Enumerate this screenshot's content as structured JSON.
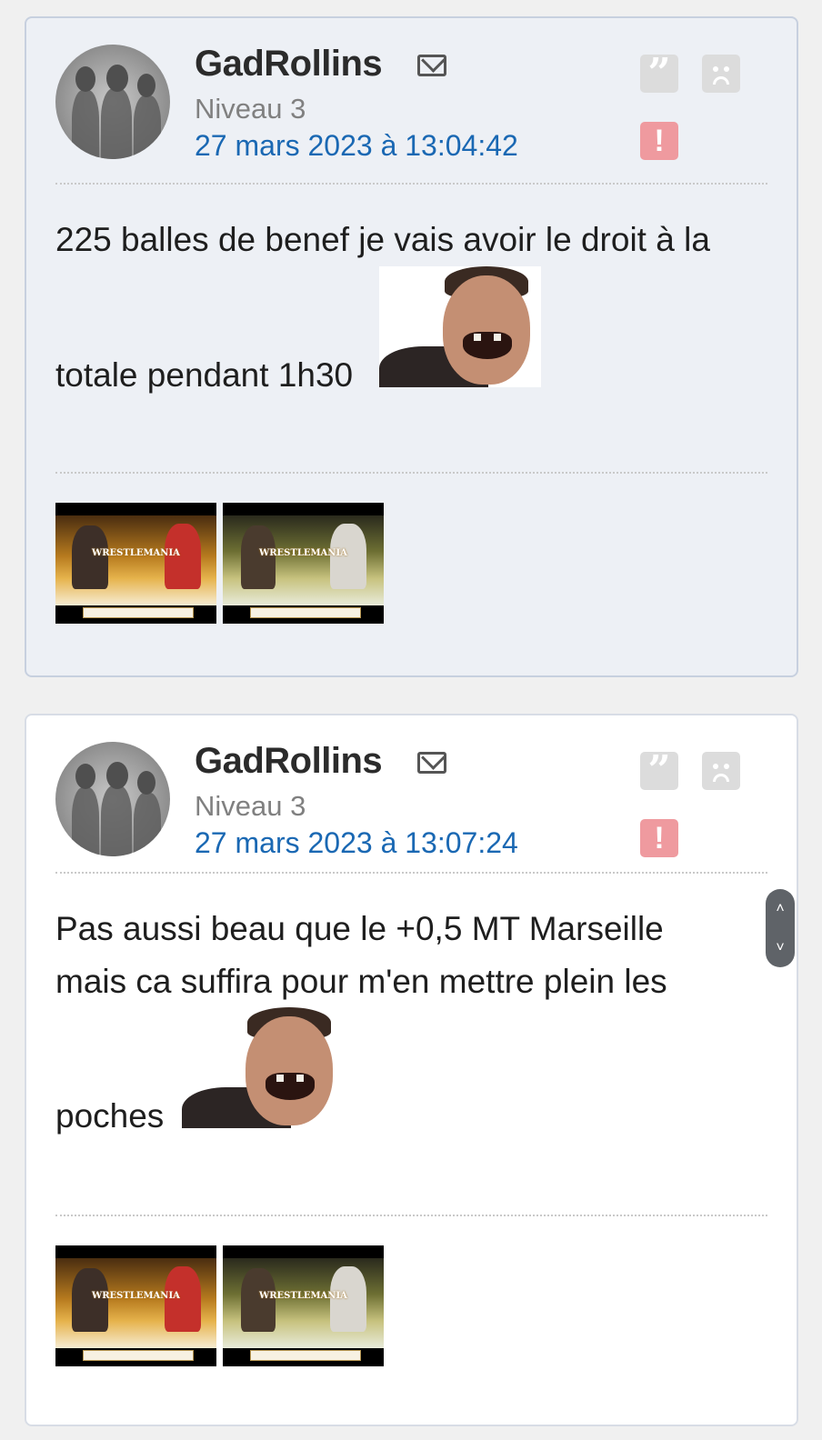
{
  "posts": [
    {
      "author": "GadRollins",
      "level": "Niveau 3",
      "date": "27 mars 2023 à 13:04:42",
      "lines": [
        "225 balles de benef je vais avoir le droit à la",
        "totale pendant 1h30"
      ],
      "attachments": [
        "thumb-wrestlemania-1",
        "thumb-wrestlemania-2"
      ]
    },
    {
      "author": "GadRollins",
      "level": "Niveau 3",
      "date": "27 mars 2023 à 13:07:24",
      "lines": [
        "Pas aussi beau que le +0,5 MT Marseille",
        "mais ca suffira pour m'en mettre plein les",
        "poches"
      ],
      "attachments": [
        "thumb-wrestlemania-1",
        "thumb-wrestlemania-2"
      ]
    }
  ],
  "thumbs": {
    "t1_banner": "WRESTLEMANIA",
    "t2_banner": "WRESTLEMANIA"
  },
  "icons": {
    "quote": "quote-icon",
    "sad": "sad-face-icon",
    "alert": "alert-icon",
    "mail": "mail-icon",
    "scroll_up": "chevron-up-icon",
    "scroll_down": "chevron-down-icon"
  },
  "glyphs": {
    "quote": "”",
    "alert": "!",
    "up": "˄",
    "down": "˅"
  },
  "colors": {
    "date_link": "#1a68b3",
    "alert_bg": "#ef9a9f",
    "post1_bg": "#edf0f5"
  }
}
